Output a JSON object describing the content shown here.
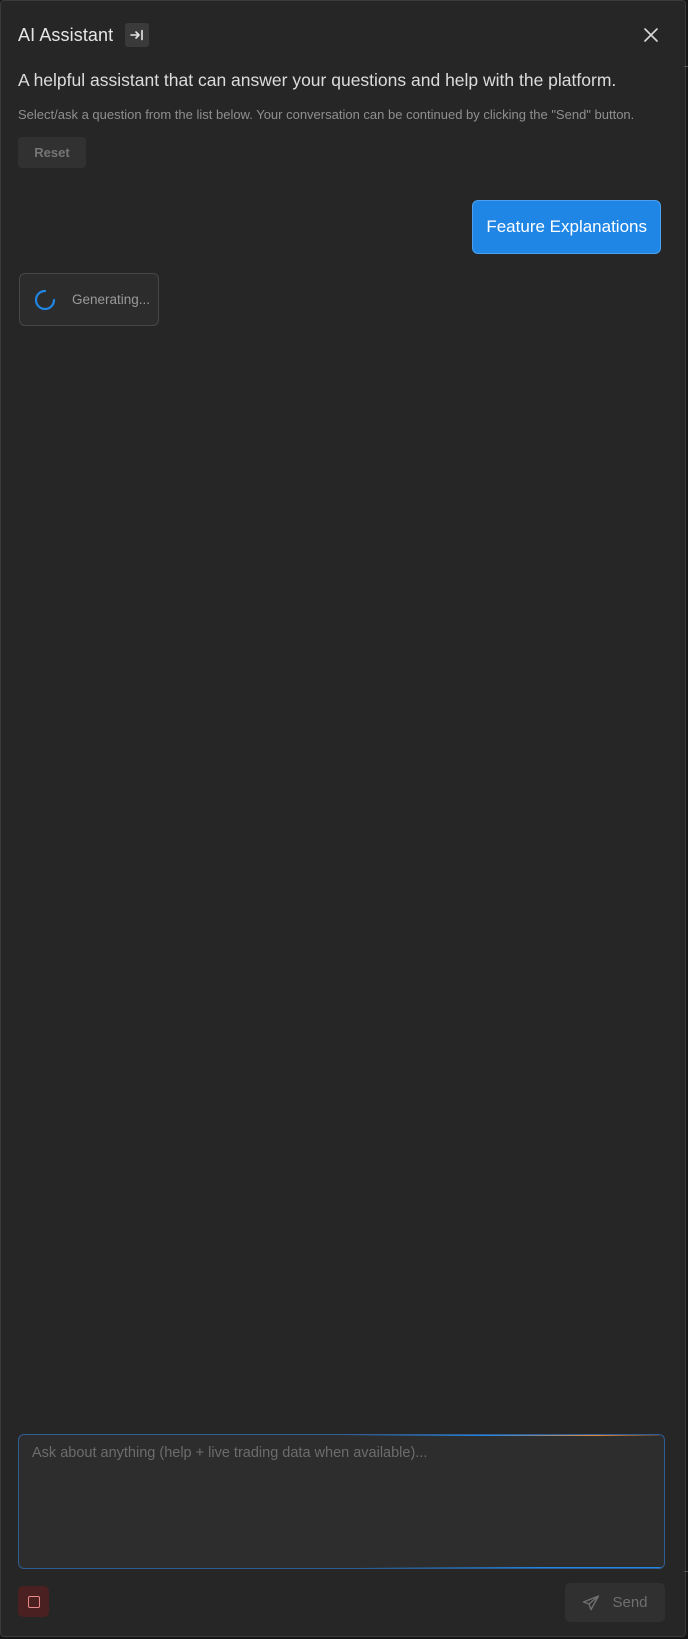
{
  "header": {
    "title": "AI Assistant"
  },
  "intro": {
    "description": "A helpful assistant that can answer your questions and help with the platform.",
    "instructions": "Select/ask a question from the list below. Your conversation can be continued by clicking the \"Send\" button.",
    "reset_label": "Reset"
  },
  "conversation": {
    "user_message": "Feature Explanations",
    "status_text": "Generating..."
  },
  "composer": {
    "placeholder": "Ask about anything (help + live trading data when available)...",
    "value": "",
    "send_label": "Send"
  },
  "colors": {
    "panel_bg": "#262626",
    "accent_blue": "#1f86e6",
    "accent_orange": "#e58a3a",
    "stop_red": "#e88a8a"
  },
  "icons": {
    "dock": "arrow-right-to-bar-icon",
    "close": "close-icon",
    "spinner": "spinner-icon",
    "stop": "stop-icon",
    "send": "paper-plane-icon"
  }
}
